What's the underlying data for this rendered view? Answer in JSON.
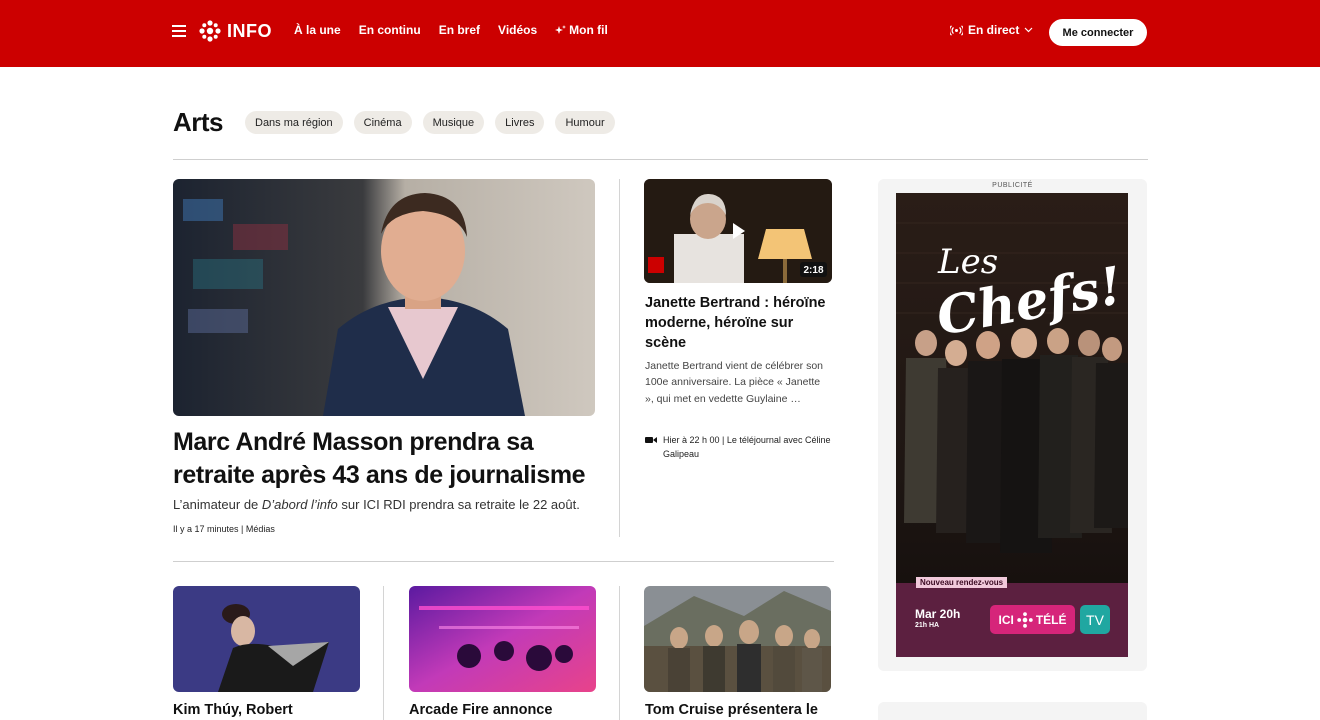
{
  "header": {
    "logo_text": "INFO",
    "nav": [
      {
        "label": "À la une"
      },
      {
        "label": "En continu"
      },
      {
        "label": "En bref"
      },
      {
        "label": "Vidéos"
      },
      {
        "label": "Mon fil",
        "icon": "sparkle-icon"
      }
    ],
    "live_label": "En direct",
    "login_label": "Me connecter",
    "brand_color": "#cc0000"
  },
  "section": {
    "title": "Arts",
    "chips": [
      {
        "label": "Dans ma région"
      },
      {
        "label": "Cinéma"
      },
      {
        "label": "Musique"
      },
      {
        "label": "Livres"
      },
      {
        "label": "Humour"
      }
    ]
  },
  "lead": {
    "title": "Marc André Masson prendra sa retraite après 43 ans de journalisme",
    "summary_prefix": "L’animateur de ",
    "summary_show": "D’abord l’info",
    "summary_suffix": " sur ICI RDI prendra sa retraite le 22 août.",
    "time": "Il y a 17 minutes",
    "category": "Médias"
  },
  "side": {
    "title": "Janette Bertrand : héroïne moderne, héroïne sur scène",
    "summary": "Janette Bertrand vient de célébrer son 100e anniversaire. La pièce « Janette », qui met en vedette Guylaine …",
    "duration": "2:18",
    "time": "Hier à 22 h 00",
    "program": "Le téléjournal avec Céline Galipeau"
  },
  "cards": [
    {
      "title": "Kim Thúy, Robert"
    },
    {
      "title": "Arcade Fire annonce"
    },
    {
      "title": "Tom Cruise présentera le"
    }
  ],
  "ad": {
    "label": "PUBLICITÉ",
    "show_title_1": "Les",
    "show_title_2": "Chefs!",
    "badge": "Nouveau rendez-vous",
    "date": "Mar 20h",
    "time": "21h HA",
    "channel": "TÉLÉ",
    "channel_prefix": "ICI",
    "tv_label": "TV"
  }
}
